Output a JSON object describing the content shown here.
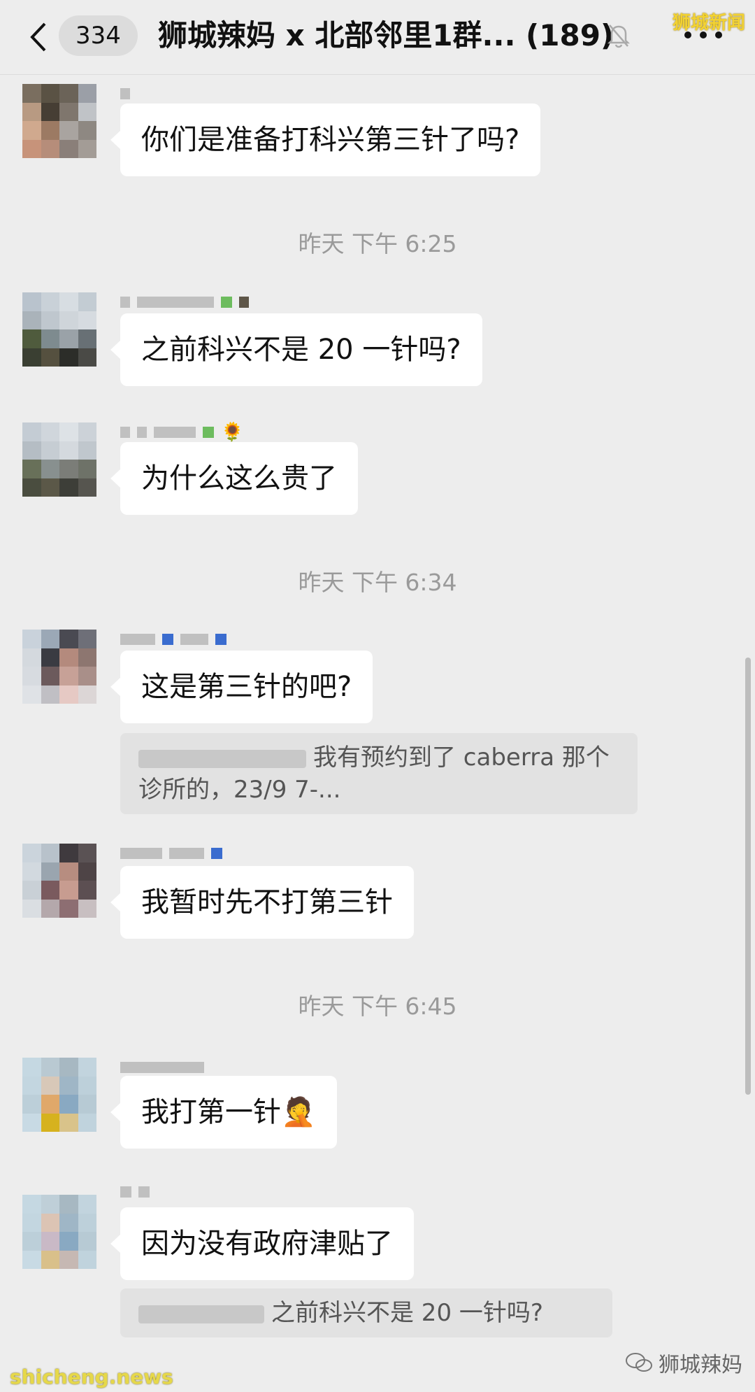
{
  "header": {
    "unread_count": "334",
    "title": "狮城辣妈 x 北部邻里1群... (189)",
    "watermark": "狮城新闻"
  },
  "messages": [
    {
      "text": "你们是准备打科兴第三针了吗?"
    },
    {
      "text": "之前科兴不是 20 一针吗?"
    },
    {
      "text": "为什么这么贵了"
    },
    {
      "text": "这是第三针的吧?",
      "quote": "我有预约到了 caberra 那个诊所的，23/9 7-..."
    },
    {
      "text": "我暂时先不打第三针"
    },
    {
      "text": "我打第一针🤦"
    },
    {
      "text": "因为没有政府津贴了",
      "quote": "之前科兴不是 20 一针吗?"
    }
  ],
  "timestamps": [
    "昨天 下午 6:25",
    "昨天 下午 6:34",
    "昨天 下午 6:45"
  ],
  "footer": {
    "site_watermark": "shicheng.news",
    "account_watermark": "狮城辣妈"
  },
  "colors": {
    "background": "#ededed",
    "bubble": "#ffffff",
    "quote": "#e2e2e2",
    "timestamp": "#9a9a9a"
  }
}
